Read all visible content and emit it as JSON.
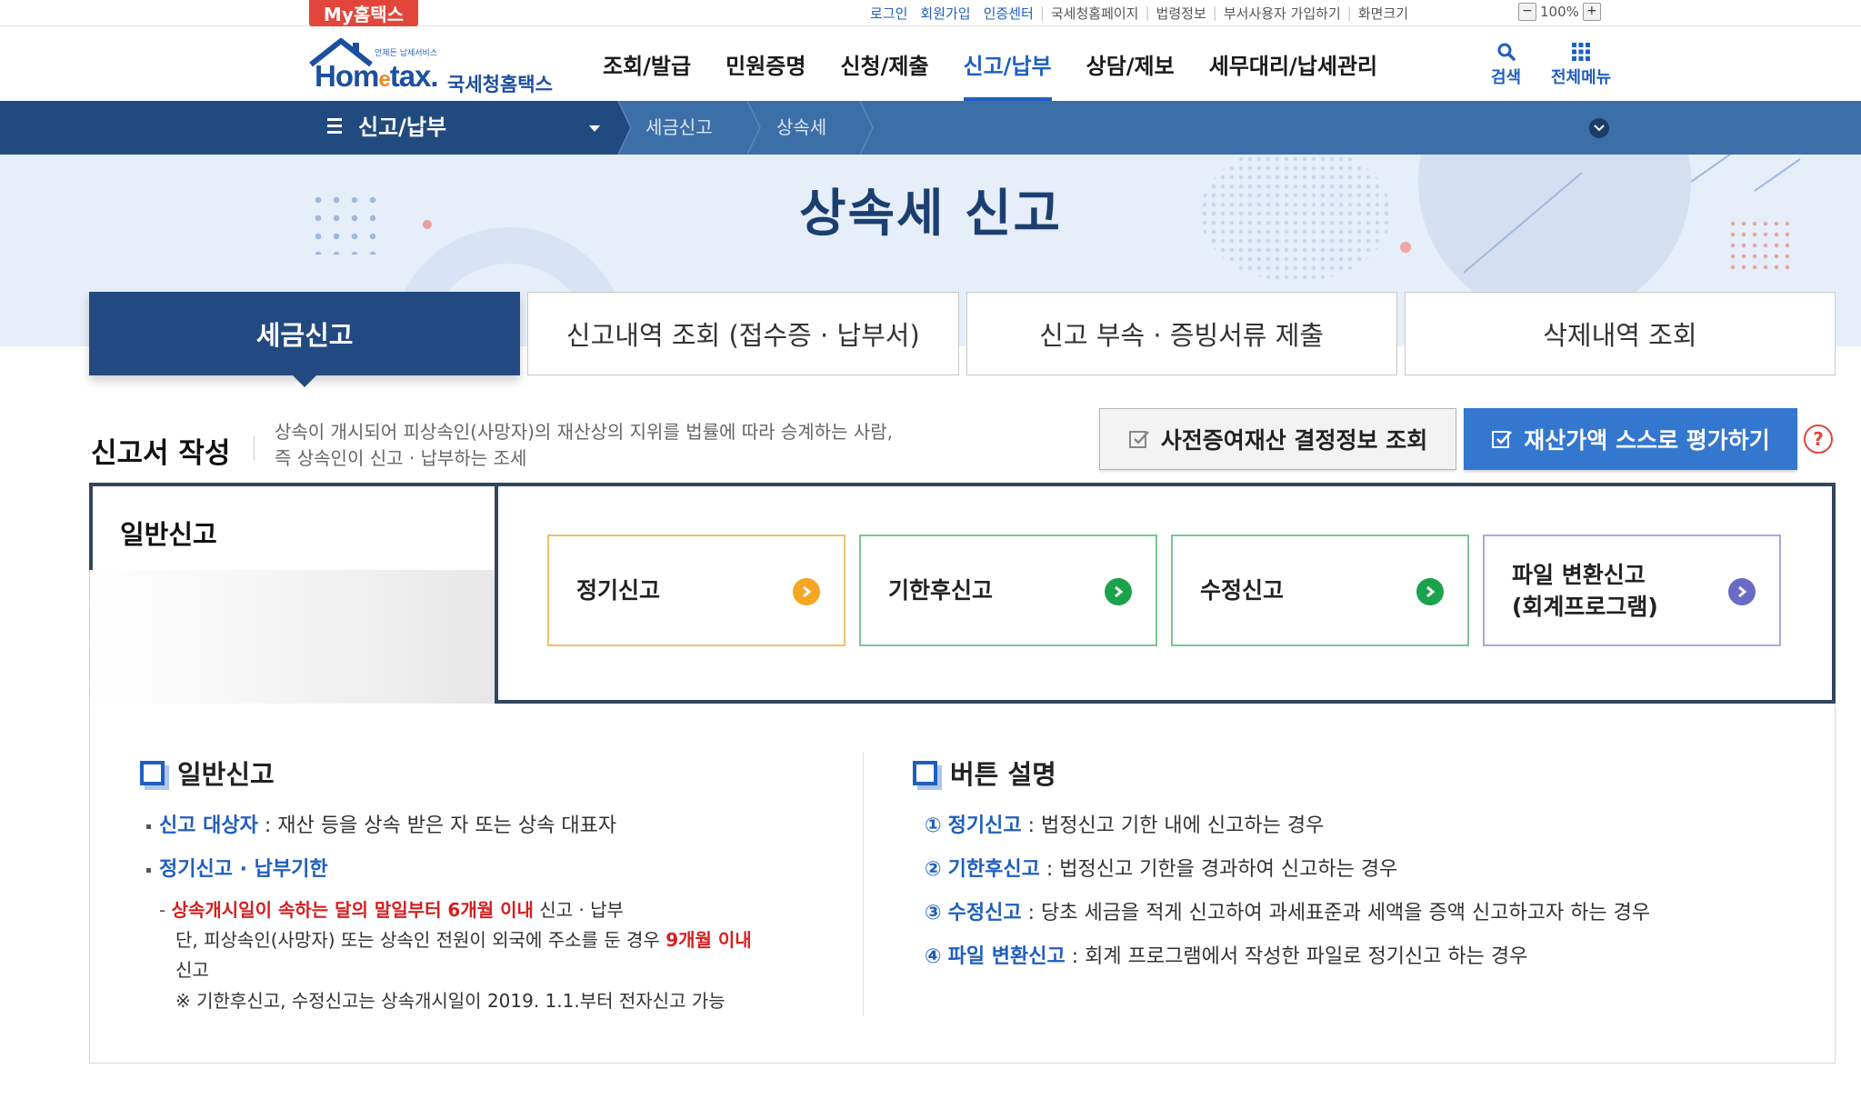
{
  "top_bar": {
    "my_hometax": "My홈택스",
    "links": [
      "로그인",
      "회원가입",
      "인증센터",
      "국세청홈페이지",
      "법령정보",
      "부서사용자 가입하기",
      "화면크기"
    ],
    "zoom_minus": "−",
    "zoom_value": "100%",
    "zoom_plus": "+"
  },
  "header": {
    "logo_small": "언제든 납세서비스",
    "logo_main_a": "Hom",
    "logo_main_e": "e",
    "logo_main_b": "tax.",
    "logo_kor": "국세청홈택스",
    "gnb": [
      "조회/발급",
      "민원증명",
      "신청/제출",
      "신고/납부",
      "상담/제보",
      "세무대리/납세관리"
    ],
    "active_gnb": "신고/납부",
    "search_label": "검색",
    "menu_label": "전체메뉴"
  },
  "location": {
    "menu_title": "신고/납부",
    "crumbs": [
      "세금신고",
      "상속세"
    ]
  },
  "page_title": "상속세 신고",
  "tabs": [
    "세금신고",
    "신고내역 조회 (접수증 · 납부서)",
    "신고 부속 · 증빙서류 제출",
    "삭제내역 조회"
  ],
  "section": {
    "title": "신고서 작성",
    "desc_line1": "상속이 개시되어 피상속인(사망자)의 재산상의 지위를 법률에 따라 승계하는 사람,",
    "desc_line2": "즉 상속인이 신고 · 납부하는 조세",
    "btn_prev_gift": "사전증여재산 결정정보 조회",
    "btn_self_eval": "재산가액 스스로 평가하기",
    "help_label": "?"
  },
  "report": {
    "tab_label": "일반신고",
    "buttons": [
      {
        "line1": "정기신고",
        "line2": "",
        "color": "#f5a623"
      },
      {
        "line1": "기한후신고",
        "line2": "",
        "color": "#1aa34a"
      },
      {
        "line1": "수정신고",
        "line2": "",
        "color": "#1aa34a"
      },
      {
        "line1": "파일 변환신고",
        "line2": "(회계프로그램)",
        "color": "#6a6ac8"
      }
    ]
  },
  "info_left": {
    "heading": "일반신고",
    "target_label": "신고 대상자",
    "target_text": " : 재산 등을 상속 받은 자 또는 상속 대표자",
    "deadline_label": "정기신고 · 납부기한",
    "dl_red": "상속개시일이 속하는 달의 말일부터 6개월 이내",
    "dl_rest": " 신고 · 납부",
    "dl2_a": "단, 피상속인(사망자) 또는 상속인 전원이 외국에 주소를 둔 경우 ",
    "dl2_red": "9개월 이내",
    "dl3": "신고",
    "note": "※ 기한후신고, 수정신고는 상속개시일이 2019. 1.1.부터 전자신고 가능"
  },
  "info_right": {
    "heading": "버튼 설명",
    "items": [
      {
        "num": "①",
        "label": "정기신고",
        "text": " : 법정신고 기한 내에 신고하는 경우"
      },
      {
        "num": "②",
        "label": "기한후신고",
        "text": " : 법정신고 기한을 경과하여 신고하는 경우"
      },
      {
        "num": "③",
        "label": "수정신고",
        "text": " : 당초 세금을 적게 신고하여 과세표준과 세액을 증액 신고하고자 하는 경우"
      },
      {
        "num": "④",
        "label": "파일 변환신고",
        "text": " : 회계 프로그램에서 작성한 파일로 정기신고 하는 경우"
      }
    ]
  }
}
